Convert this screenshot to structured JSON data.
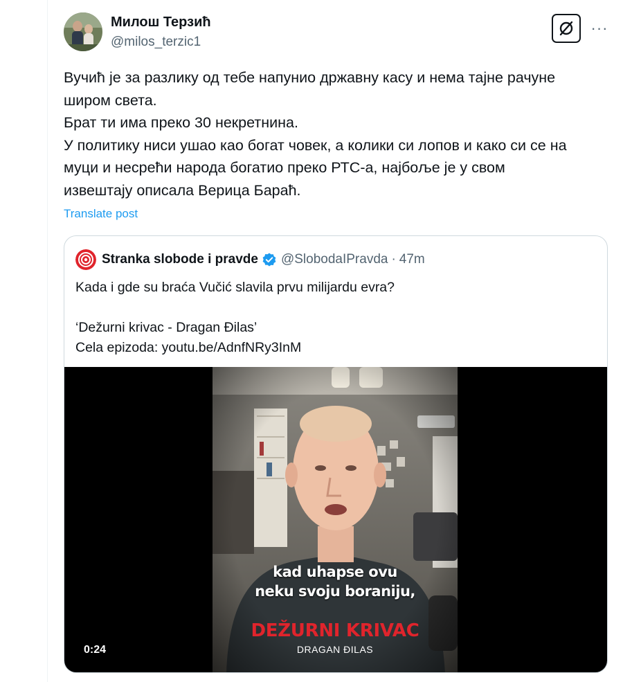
{
  "post": {
    "author_name": "Милош Терзић",
    "author_handle": "@milos_terzic1",
    "lines": [
      "Вучић је за разлику од тебе напунио државну касу и нема тајне рачуне",
      "широм света.",
      "Брат ти има преко 30 некретнина.",
      "У политику ниси ушао као богат човек, а колики си лопов и како си се на",
      "муци и несрећи народа богатио преко РТС-а, најбоље је у свом",
      "извештају описала Верица Бараћ."
    ],
    "translate_label": "Translate post",
    "more_label": "···"
  },
  "quote": {
    "author_name": "Stranka slobode i pravde",
    "handle": "@SlobodaIPravda",
    "separator": "·",
    "time": "47m",
    "lines": [
      "Kada i gde su braća Vučić slavila prvu milijardu evra?",
      "",
      "‘Dežurni krivac - Dragan Đilas’",
      "Cela epizoda: youtu.be/AdnfNRy3InM"
    ]
  },
  "video": {
    "subtitle_line1": "kad uhapse ovu",
    "subtitle_line2": "neku svoju boraniju,",
    "brand_title": "DEŽURNI KRIVAC",
    "brand_subtitle": "DRAGAN ĐILAS",
    "duration": "0:24"
  },
  "colors": {
    "link": "#1d9bf0",
    "secondary_text": "#536471",
    "verified": "#1d9bf0",
    "brand_red": "#e0242c"
  },
  "icons": {
    "grok": "slashed-circle-icon",
    "more": "more-dots-icon",
    "verified": "verified-badge-icon"
  }
}
